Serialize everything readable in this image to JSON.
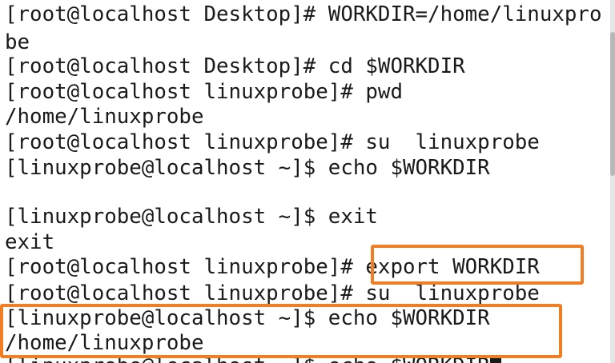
{
  "terminal": {
    "lines": [
      "[root@localhost Desktop]# WORKDIR=/home/linuxpro",
      "be",
      "[root@localhost Desktop]# cd $WORKDIR",
      "[root@localhost linuxprobe]# pwd",
      "/home/linuxprobe",
      "[root@localhost linuxprobe]# su  linuxprobe",
      "[linuxprobe@localhost ~]$ echo $WORKDIR",
      "",
      "[linuxprobe@localhost ~]$ exit",
      "exit",
      "[root@localhost linuxprobe]# export WORKDIR",
      "[root@localhost linuxprobe]# su  linuxprobe",
      "[linuxprobe@localhost ~]$ echo $WORKDIR",
      "/home/linuxprobe",
      "[linuxprobe@localhost ~]$ echo $WORKDIR"
    ]
  },
  "colors": {
    "background": "#ffffff",
    "text": "#1a1a1a",
    "highlight": "#f07e24"
  }
}
